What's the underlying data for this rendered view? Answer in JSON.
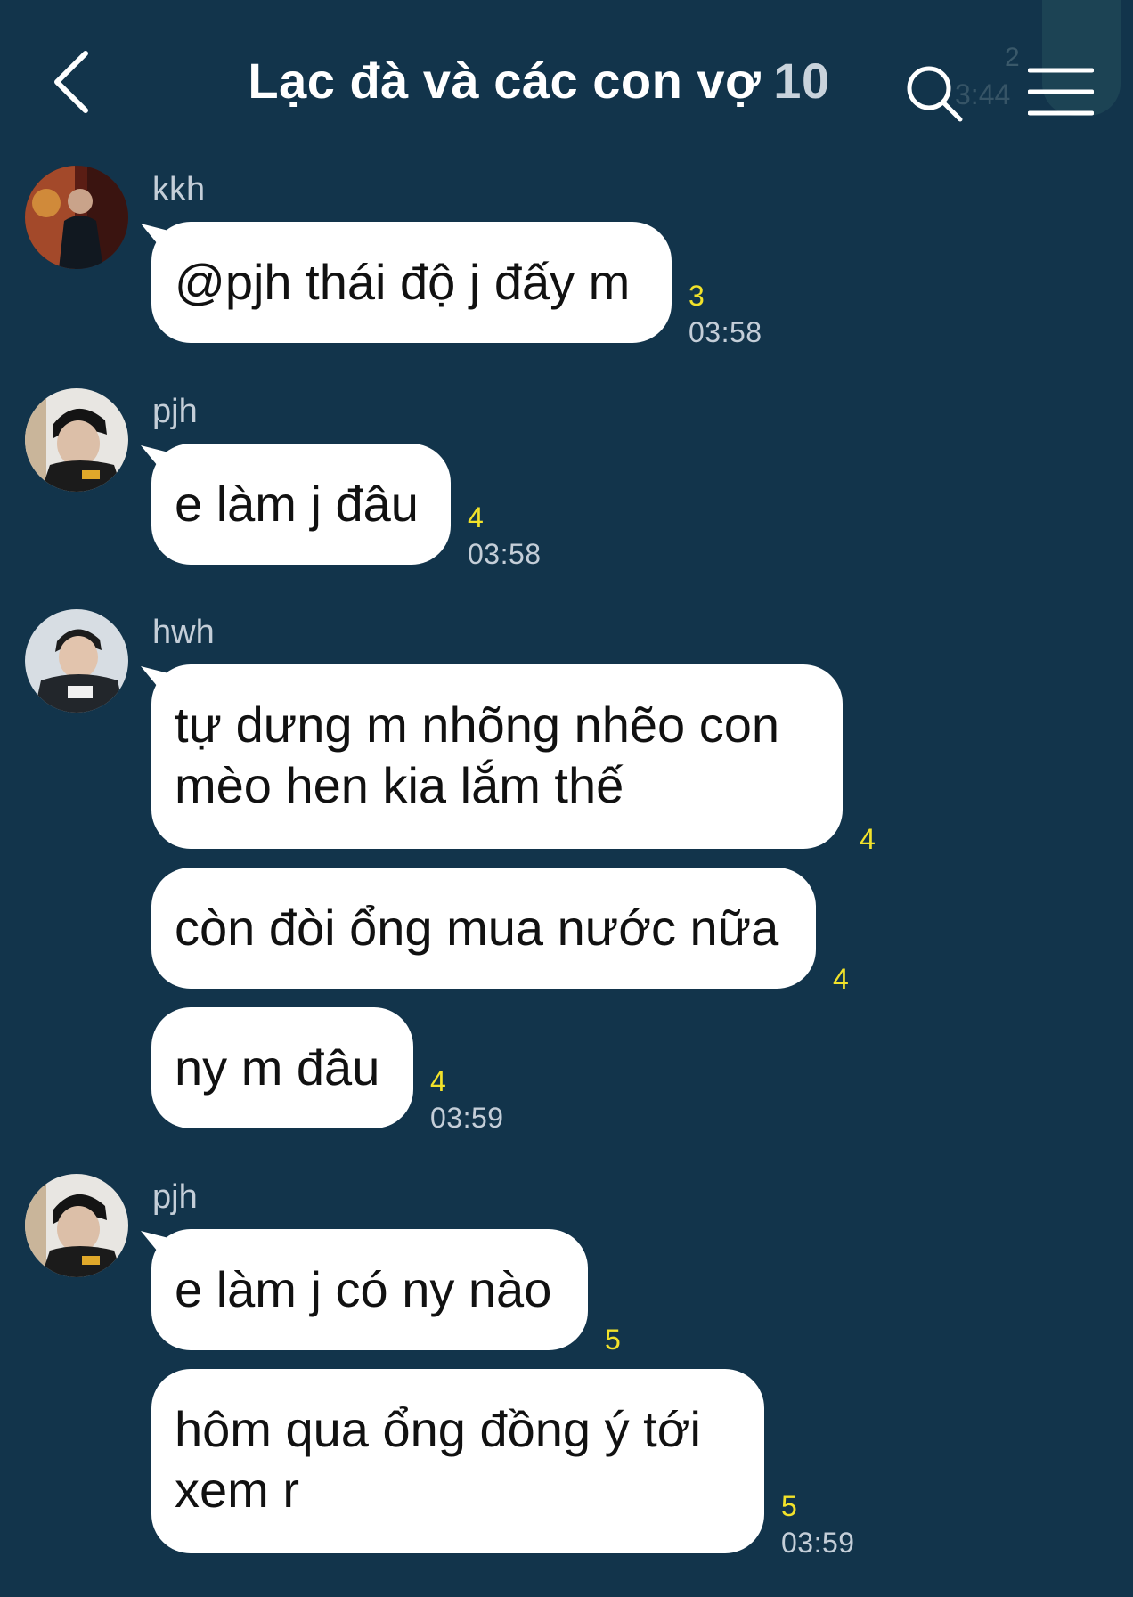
{
  "header": {
    "title": "Lạc đà và các con vợ",
    "member_count": "10",
    "ghost_unread": "2",
    "ghost_time": "3:44"
  },
  "messages": [
    {
      "sender": "kkh",
      "text_lines": [
        "@pjh thái độ j đấy m"
      ],
      "unread": "3",
      "time": "03:58"
    },
    {
      "sender": "pjh",
      "text_lines": [
        "e làm j đâu"
      ],
      "unread": "4",
      "time": "03:58"
    },
    {
      "sender": "hwh",
      "text_lines": [
        "tự dưng m nhõng nhẽo con",
        "mèo hen kia lắm thế"
      ],
      "unread": "4",
      "time": ""
    },
    {
      "sender": "",
      "text_lines": [
        "còn đòi ổng mua nước nữa"
      ],
      "unread": "4",
      "time": ""
    },
    {
      "sender": "",
      "text_lines": [
        "ny m đâu"
      ],
      "unread": "4",
      "time": "03:59"
    },
    {
      "sender": "pjh",
      "text_lines": [
        "e làm j có ny nào"
      ],
      "unread": "5",
      "time": ""
    },
    {
      "sender": "",
      "text_lines": [
        "hôm qua ổng đồng ý tới",
        "xem r"
      ],
      "unread": "5",
      "time": "03:59"
    }
  ],
  "colors": {
    "background": "#12344b",
    "bubble": "#ffffff",
    "unread": "#f2e22a",
    "meta_text": "#c4ced8"
  }
}
